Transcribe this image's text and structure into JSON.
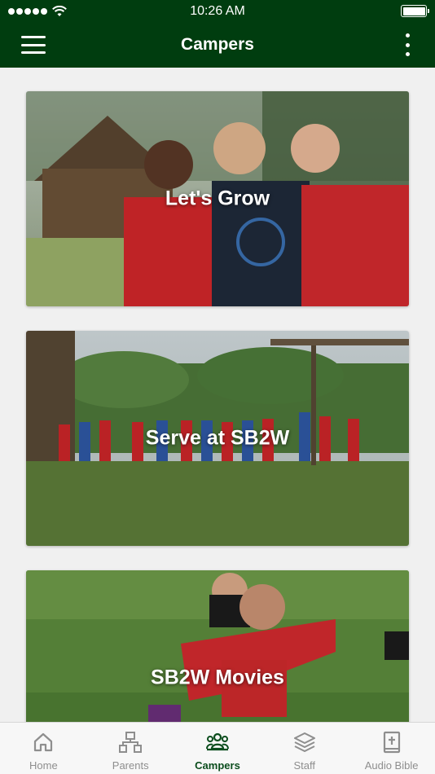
{
  "status_bar": {
    "time": "10:26 AM"
  },
  "nav": {
    "title": "Campers"
  },
  "cards": [
    {
      "label": "Let's Grow"
    },
    {
      "label": "Serve at SB2W"
    },
    {
      "label": "SB2W Movies"
    }
  ],
  "tabs": [
    {
      "label": "Home",
      "icon": "home-icon",
      "active": false
    },
    {
      "label": "Parents",
      "icon": "org-chart-icon",
      "active": false
    },
    {
      "label": "Campers",
      "icon": "group-icon",
      "active": true
    },
    {
      "label": "Staff",
      "icon": "layers-icon",
      "active": false
    },
    {
      "label": "Audio Bible",
      "icon": "bible-icon",
      "active": false
    }
  ],
  "colors": {
    "header": "#003d0f",
    "active_tab": "#0b4d1d",
    "inactive_tab": "#8e8e8e"
  }
}
